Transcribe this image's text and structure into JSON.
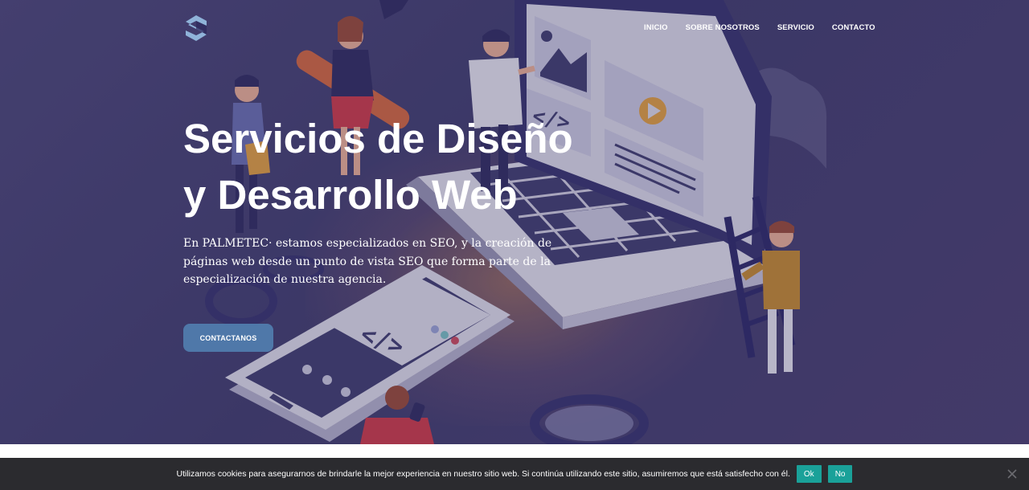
{
  "nav": {
    "logo_icon": "palmetec-logo-icon",
    "items": [
      {
        "label": "INICIO"
      },
      {
        "label": "SOBRE NOSOTROS"
      },
      {
        "label": "SERVICIO"
      },
      {
        "label": "CONTACTO"
      }
    ]
  },
  "hero": {
    "title_line1": "Servicios de Diseño",
    "title_line2": "y Desarrollo Web",
    "description": "En PALMETEC· estamos especializados en SEO, y la creación de páginas web desde un punto de vista SEO que forma parte de la especialización de nuestra agencia.",
    "cta_label": "CONTACTANOS",
    "illustration_icon": "web-development-illustration",
    "accent_color": "#4f78a9"
  },
  "cookie_bar": {
    "text": "Utilizamos cookies para asegurarnos de brindarle la mejor experiencia en nuestro sitio web. Si continúa utilizando este sitio, asumiremos que está satisfecho con él.",
    "accept_label": "Ok",
    "reject_label": "No",
    "close_icon": "close-icon",
    "button_color": "#1aa199"
  }
}
